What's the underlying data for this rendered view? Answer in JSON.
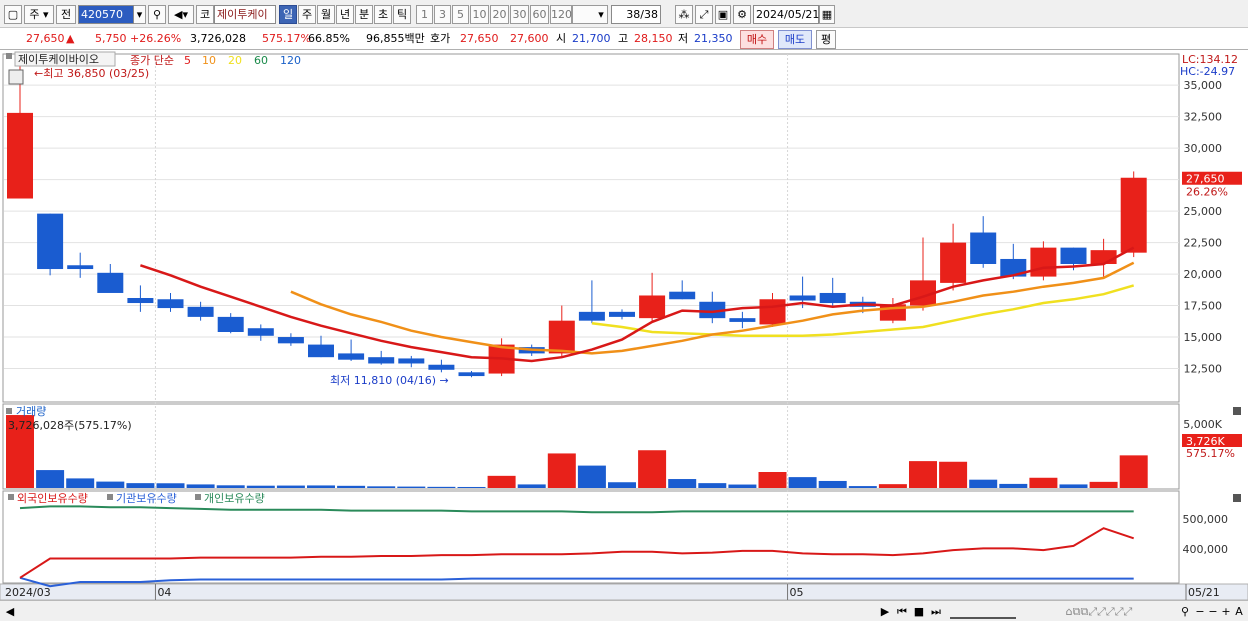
{
  "toolbar": {
    "market": "주",
    "type": "전",
    "code": "420570",
    "quote_label": "코",
    "stock_name": "제이투케이",
    "periods": [
      "일",
      "주",
      "월",
      "년",
      "분",
      "초",
      "틱"
    ],
    "selected_period": "일",
    "minutes": [
      "1",
      "3",
      "5",
      "10",
      "20",
      "30",
      "60",
      "120"
    ],
    "count": "38",
    "count_total": "/38",
    "date": "2024/05/21"
  },
  "infobar": {
    "price": "27,650",
    "change": "5,750",
    "change_rate": "+26.26%",
    "volume": "3,726,028",
    "volume_ratio": "575.17%",
    "turnover": "66.85%",
    "amount": "96,855백만",
    "bid_label": "호가",
    "ask_price": "27,650",
    "bid_price": "27,600",
    "open_label": "시",
    "open": "21,700",
    "high_label": "고",
    "high": "28,150",
    "low_label": "저",
    "low": "21,350",
    "buy": "매수",
    "sell": "매도",
    "eval": "평"
  },
  "legend": {
    "name": "제이투케이바이오",
    "close_label": "종가 단순",
    "ma": [
      {
        "label": "5",
        "color": "#e01a1a"
      },
      {
        "label": "10",
        "color": "#f09018"
      },
      {
        "label": "20",
        "color": "#f0e020"
      },
      {
        "label": "60",
        "color": "#1a8a4a"
      },
      {
        "label": "120",
        "color": "#1a60c8"
      }
    ],
    "lc": "LC:134.12",
    "hc": "HC:-24.97"
  },
  "annotations": {
    "high": "최고 36,850 (03/25)",
    "low": "최저 11,810 (04/16)"
  },
  "volume_panel": {
    "title": "거래량",
    "value": "3,726,028주(575.17%)",
    "axis": [
      "5,000K"
    ],
    "current": "3,726K",
    "current_rate": "575.17%"
  },
  "holding_panel": {
    "labels": [
      "외국인보유수량",
      "기관보유수량",
      "개인보유수량"
    ],
    "axis": [
      "500,000",
      "400,000"
    ]
  },
  "x_labels": [
    {
      "label": "2024/03",
      "i": 0
    },
    {
      "label": "04",
      "i": 5
    },
    {
      "label": "05",
      "i": 26
    },
    {
      "label": "05/21",
      "i": 38
    }
  ],
  "price_labels": {
    "current": "27,650",
    "rate": "26.26%"
  },
  "chart_data": {
    "type": "candlestick",
    "y_ticks": [
      12500,
      15000,
      17500,
      20000,
      22500,
      25000,
      27500,
      30000,
      32500,
      35000
    ],
    "ylim": [
      10000,
      37000
    ],
    "candles": [
      {
        "o": 26000,
        "h": 36850,
        "l": 26000,
        "c": 32800
      },
      {
        "o": 24800,
        "h": 24800,
        "l": 19900,
        "c": 20400
      },
      {
        "o": 20700,
        "h": 21700,
        "l": 19700,
        "c": 20400
      },
      {
        "o": 20100,
        "h": 20800,
        "l": 18600,
        "c": 18500
      },
      {
        "o": 18100,
        "h": 19100,
        "l": 17000,
        "c": 17700
      },
      {
        "o": 18000,
        "h": 18500,
        "l": 17000,
        "c": 17300
      },
      {
        "o": 17400,
        "h": 17800,
        "l": 16300,
        "c": 16600
      },
      {
        "o": 16600,
        "h": 16900,
        "l": 15300,
        "c": 15400
      },
      {
        "o": 15700,
        "h": 16000,
        "l": 14700,
        "c": 15100
      },
      {
        "o": 15000,
        "h": 15300,
        "l": 14300,
        "c": 14500
      },
      {
        "o": 14400,
        "h": 15100,
        "l": 13400,
        "c": 13400
      },
      {
        "o": 13700,
        "h": 14800,
        "l": 13100,
        "c": 13200
      },
      {
        "o": 13400,
        "h": 13900,
        "l": 12800,
        "c": 12900
      },
      {
        "o": 13300,
        "h": 13500,
        "l": 12600,
        "c": 12900
      },
      {
        "o": 12800,
        "h": 13200,
        "l": 12200,
        "c": 12400
      },
      {
        "o": 12200,
        "h": 12300,
        "l": 11810,
        "c": 11900
      },
      {
        "o": 12100,
        "h": 14900,
        "l": 11900,
        "c": 14400
      },
      {
        "o": 14200,
        "h": 14400,
        "l": 13500,
        "c": 13700
      },
      {
        "o": 13700,
        "h": 17500,
        "l": 13400,
        "c": 16300
      },
      {
        "o": 17000,
        "h": 19500,
        "l": 16100,
        "c": 16300
      },
      {
        "o": 17000,
        "h": 17200,
        "l": 16400,
        "c": 16600
      },
      {
        "o": 16500,
        "h": 20100,
        "l": 16300,
        "c": 18300
      },
      {
        "o": 18600,
        "h": 19500,
        "l": 18000,
        "c": 18000
      },
      {
        "o": 17800,
        "h": 18600,
        "l": 16100,
        "c": 16500
      },
      {
        "o": 16500,
        "h": 17000,
        "l": 15700,
        "c": 16200
      },
      {
        "o": 16000,
        "h": 18500,
        "l": 15800,
        "c": 18000
      },
      {
        "o": 18300,
        "h": 19800,
        "l": 17300,
        "c": 17900
      },
      {
        "o": 18500,
        "h": 19700,
        "l": 17400,
        "c": 17700
      },
      {
        "o": 17800,
        "h": 18200,
        "l": 16900,
        "c": 17400
      },
      {
        "o": 16300,
        "h": 18100,
        "l": 16100,
        "c": 17600
      },
      {
        "o": 17500,
        "h": 22900,
        "l": 17100,
        "c": 19500
      },
      {
        "o": 19300,
        "h": 24000,
        "l": 18700,
        "c": 22500
      },
      {
        "o": 23300,
        "h": 24600,
        "l": 20500,
        "c": 20800
      },
      {
        "o": 21200,
        "h": 22400,
        "l": 19600,
        "c": 19800
      },
      {
        "o": 19800,
        "h": 22600,
        "l": 19500,
        "c": 22100
      },
      {
        "o": 22100,
        "h": 22100,
        "l": 20300,
        "c": 20800
      },
      {
        "o": 20800,
        "h": 22800,
        "l": 19800,
        "c": 21900
      },
      {
        "o": 21700,
        "h": 28150,
        "l": 21350,
        "c": 27650
      }
    ],
    "ma5": [
      null,
      null,
      null,
      null,
      20700,
      19900,
      19000,
      18200,
      17400,
      16600,
      15900,
      15300,
      14700,
      14200,
      13800,
      13400,
      13300,
      13100,
      13400,
      14000,
      14800,
      16200,
      17100,
      17000,
      17300,
      17400,
      17700,
      17400,
      17600,
      17500,
      18200,
      19000,
      19500,
      19900,
      20500,
      20600,
      20800,
      22100
    ],
    "ma10": [
      null,
      null,
      null,
      null,
      null,
      null,
      null,
      null,
      null,
      18600,
      17600,
      16800,
      16200,
      15500,
      15000,
      14600,
      14200,
      14000,
      13900,
      13700,
      13900,
      14300,
      14700,
      15200,
      15500,
      15900,
      16300,
      16800,
      17100,
      17300,
      17400,
      17800,
      18300,
      18600,
      19000,
      19300,
      19700,
      20900
    ],
    "ma20": [
      null,
      null,
      null,
      null,
      null,
      null,
      null,
      null,
      null,
      null,
      null,
      null,
      null,
      null,
      null,
      null,
      null,
      null,
      null,
      16100,
      15800,
      15400,
      15300,
      15200,
      15100,
      15100,
      15100,
      15200,
      15400,
      15600,
      15800,
      16300,
      16800,
      17200,
      17700,
      18000,
      18400,
      19100
    ],
    "volume": [
      5700,
      1400,
      750,
      500,
      380,
      370,
      280,
      210,
      180,
      190,
      200,
      170,
      130,
      110,
      90,
      80,
      950,
      280,
      2700,
      1750,
      450,
      2950,
      700,
      380,
      270,
      1250,
      850,
      550,
      150,
      300,
      2100,
      2050,
      650,
      320,
      800,
      280,
      480,
      2550
    ],
    "volume_max": 5000,
    "foreign": [
      5,
      28,
      28,
      28,
      28,
      28,
      29,
      29,
      29,
      29,
      30,
      30,
      31,
      31,
      32,
      32,
      33,
      33,
      33,
      34,
      36,
      36,
      34,
      35,
      37,
      37,
      34,
      33,
      33,
      32,
      34,
      38,
      40,
      40,
      38,
      43,
      64,
      52
    ],
    "institution": [
      5,
      -5,
      0,
      0,
      0,
      2,
      3,
      3,
      3,
      3,
      3,
      3,
      3,
      3,
      3,
      4,
      4,
      4,
      4,
      4,
      4,
      4,
      4,
      4,
      4,
      4,
      4,
      4,
      4,
      4,
      4,
      4,
      4,
      4,
      4,
      4,
      4,
      4
    ],
    "individual": [
      88,
      90,
      90,
      89,
      89,
      88,
      87,
      86,
      86,
      86,
      86,
      85,
      85,
      85,
      85,
      84,
      84,
      84,
      84,
      83,
      83,
      83,
      84,
      84,
      84,
      84,
      84,
      84,
      84,
      84,
      84,
      84,
      84,
      84,
      84,
      84,
      84,
      84
    ]
  }
}
